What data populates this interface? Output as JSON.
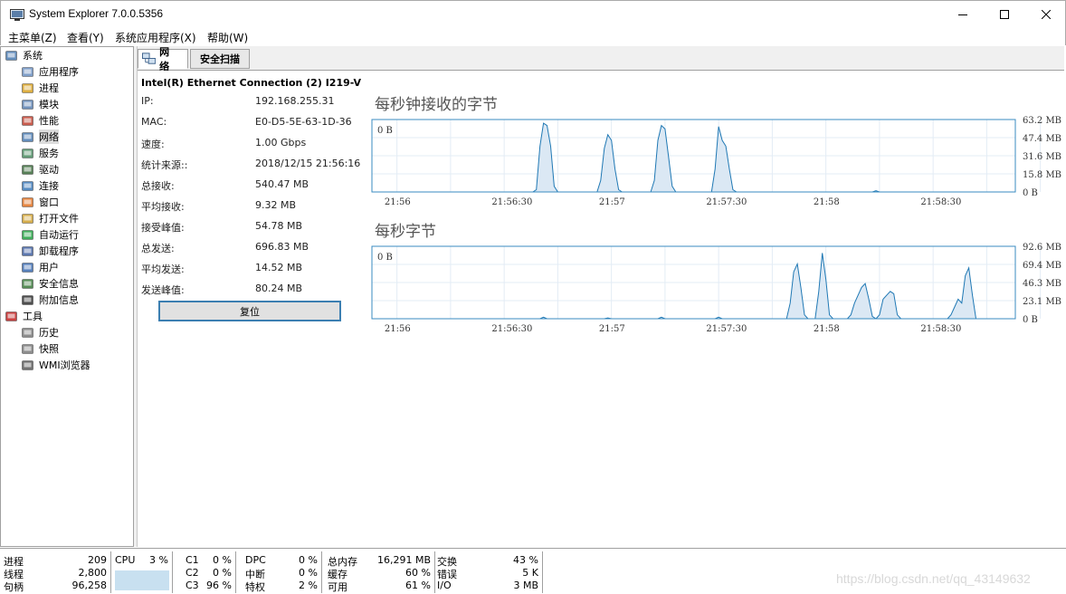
{
  "window": {
    "title": "System Explorer 7.0.0.5356"
  },
  "menu": [
    "主菜单(Z)",
    "查看(Y)",
    "系统应用程序(X)",
    "帮助(W)"
  ],
  "sidebar": {
    "items": [
      {
        "label": "系统",
        "icon": "computer-icon",
        "level": 0
      },
      {
        "label": "应用程序",
        "icon": "applications-icon",
        "level": 1
      },
      {
        "label": "进程",
        "icon": "processes-icon",
        "level": 1
      },
      {
        "label": "模块",
        "icon": "modules-icon",
        "level": 1
      },
      {
        "label": "性能",
        "icon": "performance-icon",
        "level": 1
      },
      {
        "label": "网络",
        "icon": "network-icon",
        "level": 1,
        "selected": true
      },
      {
        "label": "服务",
        "icon": "services-icon",
        "level": 1
      },
      {
        "label": "驱动",
        "icon": "drivers-icon",
        "level": 1
      },
      {
        "label": "连接",
        "icon": "connections-icon",
        "level": 1
      },
      {
        "label": "窗口",
        "icon": "windows-icon",
        "level": 1
      },
      {
        "label": "打开文件",
        "icon": "open-files-icon",
        "level": 1
      },
      {
        "label": "自动运行",
        "icon": "autorun-icon",
        "level": 1
      },
      {
        "label": "卸载程序",
        "icon": "uninstallers-icon",
        "level": 1
      },
      {
        "label": "用户",
        "icon": "users-icon",
        "level": 1
      },
      {
        "label": "安全信息",
        "icon": "security-info-icon",
        "level": 1
      },
      {
        "label": "附加信息",
        "icon": "additional-info-icon",
        "level": 1
      },
      {
        "label": "工具",
        "icon": "toolbox-icon",
        "level": 0
      },
      {
        "label": "历史",
        "icon": "history-icon",
        "level": 1
      },
      {
        "label": "快照",
        "icon": "snapshot-icon",
        "level": 1
      },
      {
        "label": "WMI浏览器",
        "icon": "wmi-browser-icon",
        "level": 1
      }
    ]
  },
  "tabs": [
    {
      "label": "网络",
      "icon": "network-icon",
      "active": true
    },
    {
      "label": "安全扫描",
      "active": false
    }
  ],
  "adapter": {
    "name": "Intel(R) Ethernet Connection (2) I219-V",
    "stats": [
      {
        "label": "IP:",
        "value": "192.168.255.31"
      },
      {
        "label": "MAC:",
        "value": "E0-D5-5E-63-1D-36"
      },
      {
        "label": "速度:",
        "value": "1.00 Gbps"
      },
      {
        "label": "统计来源::",
        "value": "2018/12/15 21:56:16"
      },
      {
        "label": "总接收:",
        "value": "540.47 MB"
      },
      {
        "label": "平均接收:",
        "value": "9.32 MB"
      },
      {
        "label": "接受峰值:",
        "value": "54.78 MB"
      },
      {
        "label": "总发送:",
        "value": "696.83 MB"
      },
      {
        "label": "平均发送:",
        "value": "14.52 MB"
      },
      {
        "label": "发送峰值:",
        "value": "80.24 MB"
      }
    ],
    "reset_label": "复位"
  },
  "chart_data": [
    {
      "type": "area",
      "title": "每秒钟接收的字节",
      "corner_label": "0 B",
      "x_ticks": [
        "21:56",
        "21:56:30",
        "21:57",
        "21:57:30",
        "21:58",
        "21:58:30"
      ],
      "y_ticks": [
        "63.2 MB",
        "47.4 MB",
        "31.6 MB",
        "15.8 MB",
        "0 B"
      ],
      "ylim": [
        0,
        63.2
      ],
      "x_range_seconds": [
        0,
        180
      ],
      "grid": true,
      "color": "#1f78b4",
      "series": [
        {
          "values": [
            [
              0,
              0
            ],
            [
              40,
              0
            ],
            [
              45,
              0
            ],
            [
              46,
              2
            ],
            [
              47,
              40
            ],
            [
              48,
              60
            ],
            [
              49,
              58
            ],
            [
              50,
              40
            ],
            [
              51,
              5
            ],
            [
              52,
              0
            ],
            [
              63,
              0
            ],
            [
              64,
              10
            ],
            [
              65,
              38
            ],
            [
              66,
              50
            ],
            [
              67,
              45
            ],
            [
              68,
              20
            ],
            [
              69,
              2
            ],
            [
              70,
              0
            ],
            [
              78,
              0
            ],
            [
              79,
              10
            ],
            [
              80,
              45
            ],
            [
              81,
              58
            ],
            [
              82,
              55
            ],
            [
              83,
              30
            ],
            [
              84,
              5
            ],
            [
              85,
              0
            ],
            [
              95,
              0
            ],
            [
              96,
              20
            ],
            [
              97,
              57
            ],
            [
              98,
              45
            ],
            [
              99,
              40
            ],
            [
              100,
              20
            ],
            [
              101,
              2
            ],
            [
              102,
              0
            ],
            [
              140,
              0
            ],
            [
              141,
              1
            ],
            [
              142,
              0
            ],
            [
              180,
              0
            ]
          ]
        }
      ]
    },
    {
      "type": "area",
      "title": "每秒字节",
      "corner_label": "0 B",
      "x_ticks": [
        "21:56",
        "21:56:30",
        "21:57",
        "21:57:30",
        "21:58",
        "21:58:30"
      ],
      "y_ticks": [
        "92.6 MB",
        "69.4 MB",
        "46.3 MB",
        "23.1 MB",
        "0 B"
      ],
      "ylim": [
        0,
        92.6
      ],
      "x_range_seconds": [
        0,
        180
      ],
      "grid": true,
      "color": "#1f78b4",
      "series": [
        {
          "values": [
            [
              0,
              0
            ],
            [
              47,
              0
            ],
            [
              48,
              2
            ],
            [
              49,
              0
            ],
            [
              65,
              0
            ],
            [
              66,
              1
            ],
            [
              67,
              0
            ],
            [
              80,
              0
            ],
            [
              81,
              2
            ],
            [
              82,
              0
            ],
            [
              96,
              0
            ],
            [
              97,
              2
            ],
            [
              98,
              0
            ],
            [
              116,
              0
            ],
            [
              117,
              20
            ],
            [
              118,
              60
            ],
            [
              119,
              70
            ],
            [
              120,
              40
            ],
            [
              121,
              5
            ],
            [
              122,
              0
            ],
            [
              124,
              0
            ],
            [
              125,
              35
            ],
            [
              126,
              84
            ],
            [
              127,
              50
            ],
            [
              128,
              5
            ],
            [
              129,
              0
            ],
            [
              133,
              0
            ],
            [
              134,
              5
            ],
            [
              135,
              20
            ],
            [
              136,
              30
            ],
            [
              137,
              40
            ],
            [
              138,
              45
            ],
            [
              139,
              25
            ],
            [
              140,
              3
            ],
            [
              141,
              0
            ],
            [
              142,
              5
            ],
            [
              143,
              25
            ],
            [
              144,
              30
            ],
            [
              145,
              35
            ],
            [
              146,
              32
            ],
            [
              147,
              5
            ],
            [
              148,
              0
            ],
            [
              161,
              0
            ],
            [
              162,
              5
            ],
            [
              163,
              15
            ],
            [
              164,
              25
            ],
            [
              165,
              20
            ],
            [
              166,
              55
            ],
            [
              167,
              65
            ],
            [
              168,
              30
            ],
            [
              169,
              0
            ],
            [
              180,
              0
            ]
          ]
        }
      ]
    }
  ],
  "statusbar": {
    "processes": {
      "rows": [
        {
          "label": "进程",
          "value": "209"
        },
        {
          "label": "线程",
          "value": "2,800"
        },
        {
          "label": "句柄",
          "value": "96,258"
        }
      ]
    },
    "cpu": {
      "label": "CPU",
      "value": "3 %"
    },
    "cstates": {
      "rows": [
        {
          "label": "C1",
          "value": "0 %"
        },
        {
          "label": "C2",
          "value": "0 %"
        },
        {
          "label": "C3",
          "value": "96 %"
        }
      ]
    },
    "dpc": {
      "rows": [
        {
          "label": "DPC",
          "value": "0 %"
        },
        {
          "label": "中断",
          "value": "0 %"
        },
        {
          "label": "特权",
          "value": "2 %"
        }
      ]
    },
    "memory": {
      "rows": [
        {
          "label": "总内存",
          "value": "16,291 MB"
        },
        {
          "label": "缓存",
          "value": "60 %"
        },
        {
          "label": "可用",
          "value": "61 %"
        }
      ]
    },
    "swap": {
      "rows": [
        {
          "label": "交换",
          "value": "43 %"
        },
        {
          "label": "错误",
          "value": "5 K"
        },
        {
          "label": "I/O",
          "value": "3 MB"
        }
      ]
    }
  },
  "watermark": "https://blog.csdn.net/qq_43149632"
}
